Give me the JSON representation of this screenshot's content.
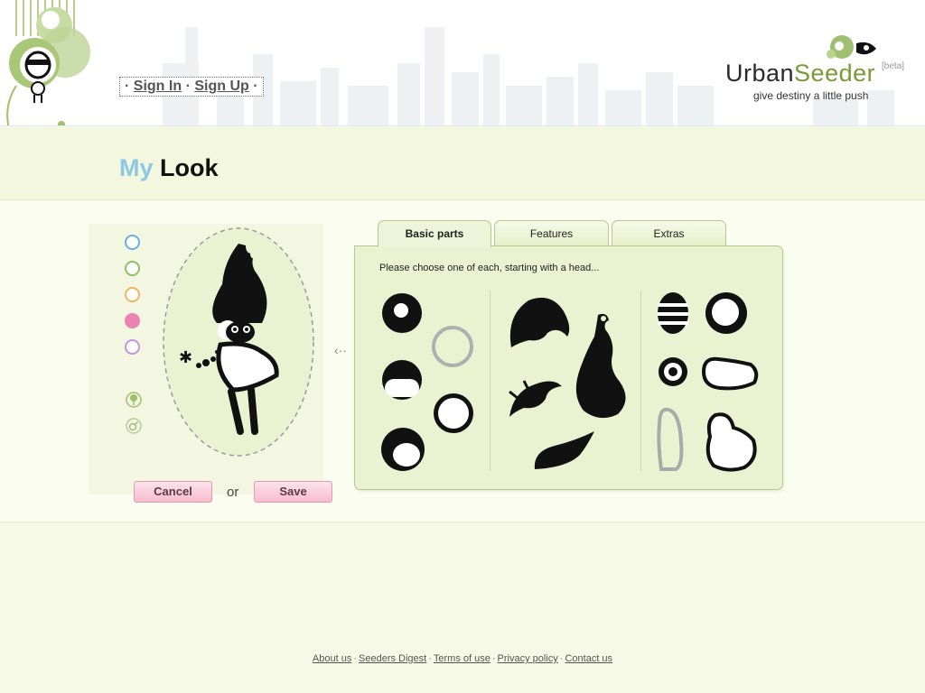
{
  "header": {
    "sign_in": "Sign In",
    "sign_up": "Sign Up",
    "sep": "·",
    "logo_urban": "Urban",
    "logo_seeder": "Seeder",
    "logo_beta": "[beta]",
    "tagline": "give destiny a little push"
  },
  "page": {
    "title_my": "My",
    "title_look": "Look"
  },
  "colors": {
    "swatches": [
      "#6aaee0",
      "#8fc060",
      "#f0b560",
      "#e984b0",
      "#c890df"
    ],
    "accent_green": "#8fb050"
  },
  "buttons": {
    "cancel": "Cancel",
    "or": "or",
    "save": "Save"
  },
  "tabs": [
    {
      "label": "Basic parts",
      "active": true
    },
    {
      "label": "Features",
      "active": false
    },
    {
      "label": "Extras",
      "active": false
    }
  ],
  "panel": {
    "hint": "Please choose one of each, starting with a head...",
    "arrow": "‹··"
  },
  "footer": {
    "links": [
      "About us",
      "Seeders Digest",
      "Terms of use",
      "Privacy policy",
      "Contact us"
    ],
    "sep": "·"
  }
}
